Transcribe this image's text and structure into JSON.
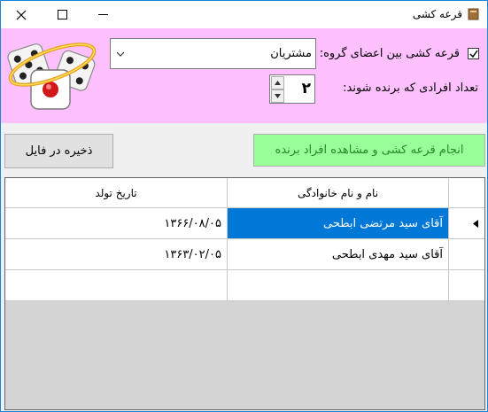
{
  "window": {
    "title": "قرعه کشی",
    "controls": [
      "minimize",
      "maximize",
      "close"
    ]
  },
  "colors": {
    "header_bg": "#ffc0ff",
    "draw_button_bg": "#99ff99",
    "draw_button_text": "#228b22",
    "selection": "#0078d7"
  },
  "form": {
    "group_checkbox_label": "قرعه کشی بین اعضای گروه:",
    "group_checkbox_checked": true,
    "group_select_value": "مشتریان",
    "winner_count_label": "تعداد افرادی که برنده شوند:",
    "winner_count_value": "۲"
  },
  "buttons": {
    "draw_label": "انجام قرعه کشی و مشاهده افراد برنده",
    "save_label": "ذخیره در فایل"
  },
  "grid": {
    "columns": [
      "نام و نام خانوادگی",
      "تاریخ تولد"
    ],
    "rows": [
      {
        "name": "آقای سید مرتضی ابطحی",
        "birth": "۱۳۶۶/۰۸/۰۵",
        "selected": true
      },
      {
        "name": "آقای سید مهدی ابطحی",
        "birth": "۱۳۶۳/۰۲/۰۵",
        "selected": false
      },
      {
        "name": "",
        "birth": "",
        "selected": false
      }
    ]
  },
  "icons": [
    "app-icon",
    "dice-logo",
    "checkmark-icon",
    "chevron-down-icon",
    "arrow-up-icon",
    "arrow-down-icon",
    "current-row-arrow-icon"
  ]
}
